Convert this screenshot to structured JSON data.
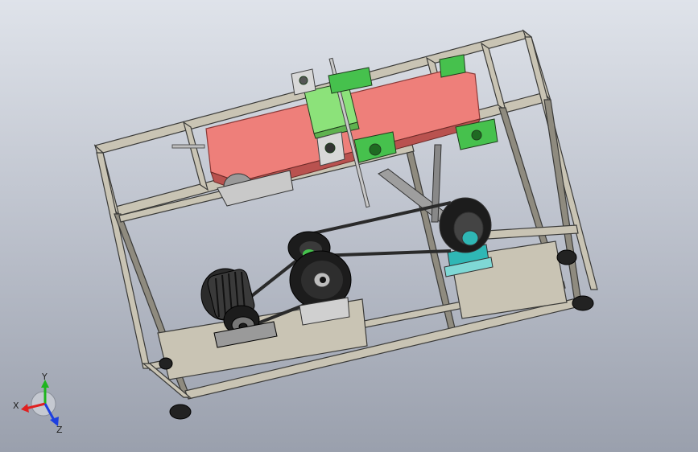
{
  "viewport": {
    "background_top": "#dfe3ea",
    "background_bottom": "#9aa0ad"
  },
  "colors": {
    "frame": "#c9c4b4",
    "frame_edge": "#3a3a38",
    "belt_red": "#ee7f7a",
    "belt_red_dark": "#b9524f",
    "bearing_green": "#46c14d",
    "bracket_green": "#8ce27a",
    "motor": "#2b2b2b",
    "pulley": "#1c1c1c",
    "drive_belt": "#2a2a2a",
    "teal_block": "#2fb7b5",
    "metal": "#bfbfbf"
  },
  "triad": {
    "x_label": "X",
    "y_label": "Y",
    "z_label": "Z",
    "x_color": "#e02020",
    "y_color": "#1fb51f",
    "z_color": "#1d3fe0"
  }
}
